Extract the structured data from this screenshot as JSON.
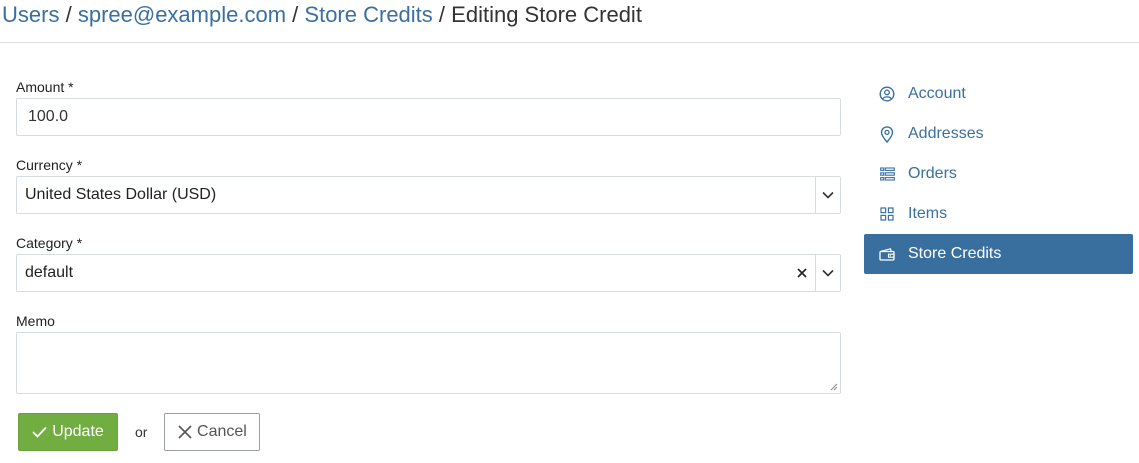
{
  "breadcrumb": {
    "items": [
      "Users",
      "spree@example.com",
      "Store Credits"
    ],
    "separator": "/",
    "current": "Editing Store Credit"
  },
  "form": {
    "amount": {
      "label": "Amount *",
      "value": "100.0"
    },
    "currency": {
      "label": "Currency *",
      "value": "United States Dollar (USD)"
    },
    "category": {
      "label": "Category *",
      "value": "default"
    },
    "memo": {
      "label": "Memo",
      "value": ""
    }
  },
  "actions": {
    "update_label": "Update",
    "or_label": "or",
    "cancel_label": "Cancel"
  },
  "sidebar": {
    "items": [
      {
        "label": "Account",
        "icon": "user-circle-icon",
        "active": false
      },
      {
        "label": "Addresses",
        "icon": "map-pin-icon",
        "active": false
      },
      {
        "label": "Orders",
        "icon": "list-icon",
        "active": false
      },
      {
        "label": "Items",
        "icon": "grid-icon",
        "active": false
      },
      {
        "label": "Store Credits",
        "icon": "wallet-icon",
        "active": true
      }
    ]
  },
  "colors": {
    "link": "#3b6fa0",
    "active_nav": "#396f9e",
    "update_button": "#72ad42"
  }
}
